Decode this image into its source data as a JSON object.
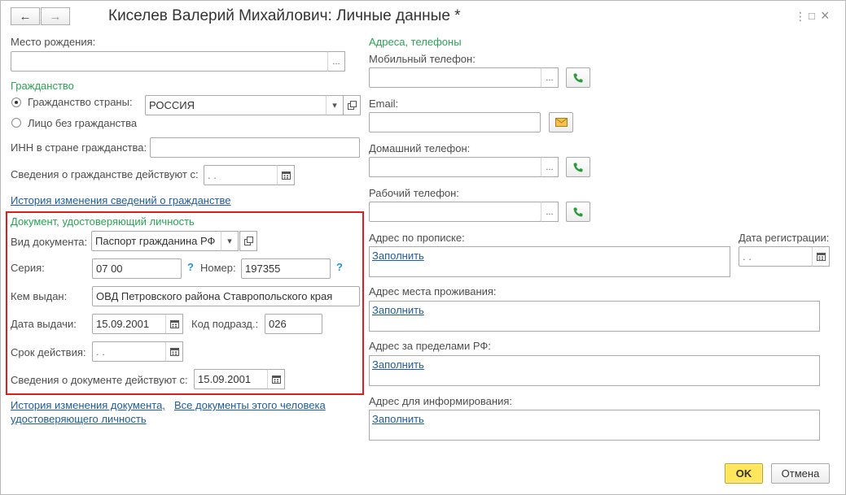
{
  "window": {
    "title": "Киселев Валерий Михайлович: Личные данные *"
  },
  "toolbar": {
    "back": "←",
    "forward": "→",
    "more": "⋮",
    "maximize": "□",
    "close": "×"
  },
  "left": {
    "birthplace_label": "Место рождения:",
    "birthplace_value": "",
    "citizenship_group": "Гражданство",
    "country_radio_label": "Гражданство страны:",
    "country_value": "РОССИЯ",
    "stateless_radio_label": "Лицо без гражданства",
    "inn_label": "ИНН в стране гражданства:",
    "inn_value": "",
    "citizenship_since_label": "Сведения о гражданстве действуют с:",
    "citizenship_since_value": " .  .",
    "citizenship_history_link": "История изменения сведений о гражданстве",
    "doc_group": "Документ, удостоверяющий личность",
    "doc_type_label": "Вид документа:",
    "doc_type_value": "Паспорт гражданина РФ",
    "series_label": "Серия:",
    "series_value": "07 00",
    "number_label": "Номер:",
    "number_value": "197355",
    "issued_by_label": "Кем выдан:",
    "issued_by_value": "ОВД Петровского района Ставропольского края",
    "issue_date_label": "Дата выдачи:",
    "issue_date_value": "15.09.2001",
    "dept_code_label": "Код подразд.:",
    "dept_code_value": "026",
    "validity_label": "Срок действия:",
    "validity_value": " .  .",
    "doc_since_label": "Сведения о документе действуют с:",
    "doc_since_value": "15.09.2001",
    "doc_history_link_1": "История изменения документа,",
    "doc_history_link_2": "удостоверяющего личность",
    "all_docs_link": "Все документы этого человека",
    "help": "?"
  },
  "right": {
    "contacts_group": "Адреса, телефоны",
    "mobile_label": "Мобильный телефон:",
    "mobile_value": "",
    "email_label": "Email:",
    "email_value": "",
    "home_phone_label": "Домашний телефон:",
    "home_phone_value": "",
    "work_phone_label": "Рабочий телефон:",
    "work_phone_value": "",
    "reg_address_label": "Адрес по прописке:",
    "reg_date_label": "Дата регистрации:",
    "reg_date_value": " .  .",
    "residence_label": "Адрес места проживания:",
    "abroad_label": "Адрес за пределами РФ:",
    "info_address_label": "Адрес для информирования:",
    "fill_link": "Заполнить"
  },
  "footer": {
    "ok": "OK",
    "cancel": "Отмена"
  },
  "common": {
    "ellipsis": "...",
    "dropdown": "▾"
  },
  "colors": {
    "group": "#2aa255",
    "link": "#1e5c9a",
    "highlight_border": "#e11d1d",
    "ok_button": "#ffe65c",
    "phone_icon": "#2a9a3a"
  }
}
